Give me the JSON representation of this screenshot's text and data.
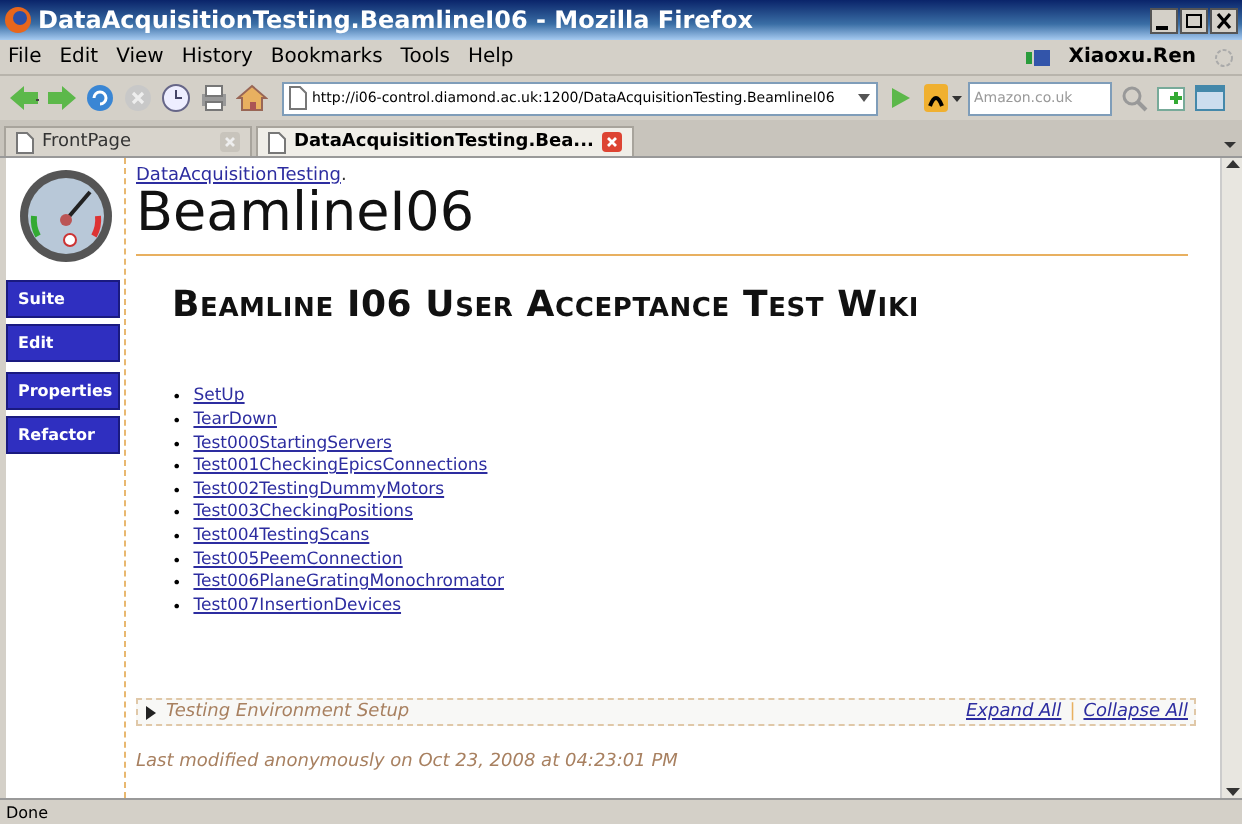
{
  "window": {
    "title": "DataAcquisitionTesting.BeamlineI06 - Mozilla Firefox"
  },
  "menu": [
    "File",
    "Edit",
    "View",
    "History",
    "Bookmarks",
    "Tools",
    "Help"
  ],
  "user": "Xiaoxu.Ren",
  "address": {
    "value": "http://i06-control.diamond.ac.uk:1200/DataAcquisitionTesting.BeamlineI06"
  },
  "search": {
    "placeholder": "Amazon.co.uk"
  },
  "tabs": [
    {
      "label": "FrontPage",
      "selected": false
    },
    {
      "label": "DataAcquisitionTesting.Bea...",
      "selected": true
    }
  ],
  "sidebar": {
    "items": [
      "Suite",
      "Edit",
      "Properties",
      "Refactor"
    ]
  },
  "breadcrumb": {
    "link": "DataAcquisitionTesting",
    "suffix": "."
  },
  "page_title": "BeamlineI06",
  "heading": "Beamline I06 User Acceptance Test Wiki",
  "bullet": "•",
  "links": [
    "SetUp",
    "TearDown",
    "Test000StartingServers",
    "Test001CheckingEpicsConnections",
    "Test002TestingDummyMotors",
    "Test003CheckingPositions",
    "Test004TestingScans",
    "Test005PeemConnection",
    "Test006PlaneGratingMonochromator",
    "Test007InsertionDevices"
  ],
  "collapsible": {
    "label": "Testing Environment Setup",
    "expanded": false,
    "actions": [
      "Expand All",
      "Collapse All"
    ],
    "separator": "|"
  },
  "footer": "Last modified anonymously on Oct 23, 2008 at 04:23:01 PM",
  "status_bar": "Done"
}
